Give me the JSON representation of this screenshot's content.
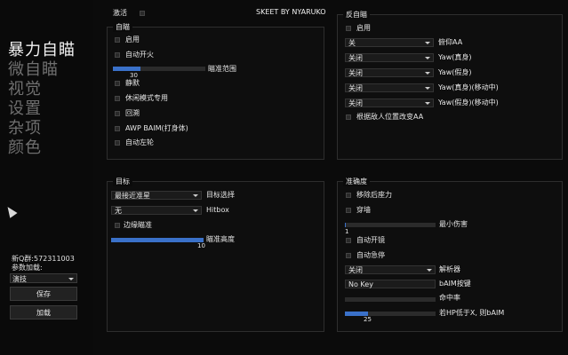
{
  "nav": [
    "暴力自瞄",
    "微自瞄",
    "视觉",
    "设置",
    "杂项",
    "颜色"
  ],
  "left": {
    "qq": "新Q群:572311003",
    "param_label": "参数加载:",
    "param_value": "演技",
    "save": "保存",
    "load": "加载"
  },
  "top": {
    "activate": "激活",
    "brand": "SKEET BY NYARUKO"
  },
  "aim": {
    "title": "自瞄",
    "enable": "启用",
    "autofire": "自动开火",
    "fov_value": "30",
    "fov_label": "瞄准范围",
    "silent": "静默",
    "casual": "休闲模式专用",
    "recoil": "回溯",
    "awp": "AWP BAIM(打身体)",
    "autorevolver": "自动左轮",
    "fov_fraction": 0.3
  },
  "target": {
    "title": "目标",
    "select_value": "最接近准星",
    "select_label": "目标选择",
    "hitbox_value": "无",
    "hitbox_label": "Hitbox",
    "edge": "边缘瞄准",
    "height_value": "10",
    "height_label": "瞄准高度",
    "height_fraction": 1.0
  },
  "anti": {
    "title": "反自瞄",
    "enable": "启用",
    "pitch_value": "关",
    "pitch_label": "俯仰AA",
    "yaw_stand_value": "关闭",
    "yaw_stand_label": "Yaw(真身)",
    "yaw_fake_value": "关闭",
    "yaw_fake_label": "Yaw(假身)",
    "yaw_stand_move_value": "关闭",
    "yaw_stand_move_label": "Yaw(真身)(移动中)",
    "yaw_fake_move_value": "关闭",
    "yaw_fake_move_label": "Yaw(假身)(移动中)",
    "by_enemy": "根据敌人位置改变AA"
  },
  "acc": {
    "title": "准确度",
    "norecoil": "移除后座力",
    "wallbang": "穿墙",
    "mindmg_value": "1",
    "mindmg_label": "最小伤害",
    "autoscope": "自动开镜",
    "autostop": "自动急停",
    "resolver_value": "关闭",
    "resolver_label": "解析器",
    "baim_key_value": "No Key",
    "baim_key_label": "bAIM按键",
    "hitchance_label": "命中率",
    "hp_value": "25",
    "hp_label": "若HP低于X, 则bAIM",
    "mindmg_fraction": 0.01,
    "hitchance_fraction": 0.0,
    "hp_fraction": 0.25
  }
}
